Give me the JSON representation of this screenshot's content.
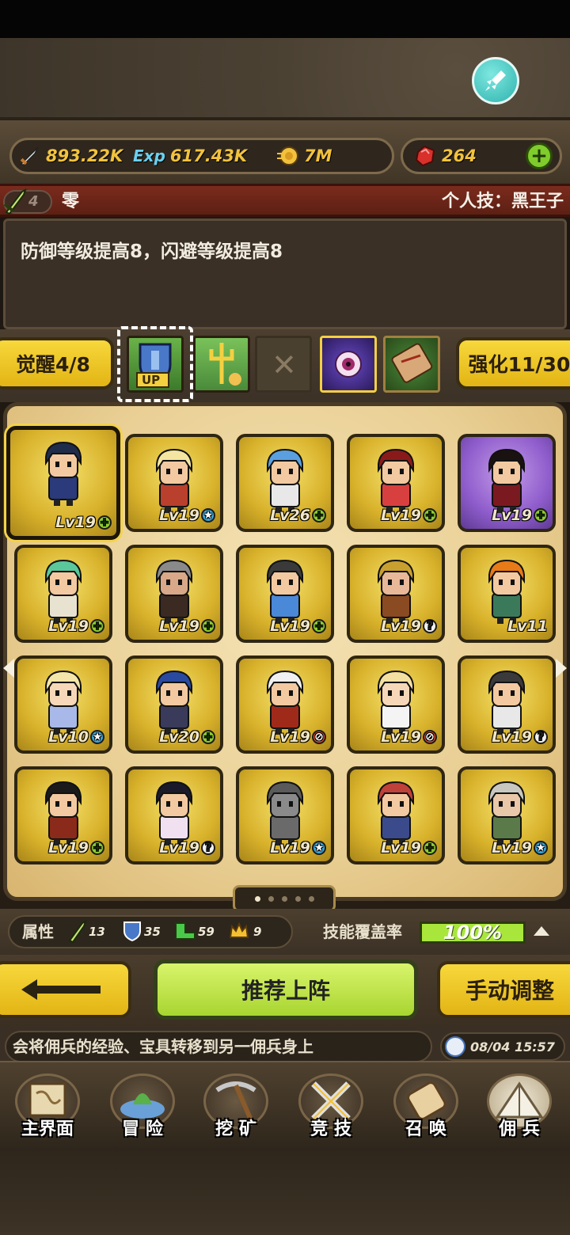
{
  "resources": {
    "attack": "893.22K",
    "exp_label": "Exp",
    "exp": "617.43K",
    "gold": "7M",
    "gems": "264"
  },
  "hero": {
    "name_rank": "4",
    "name": "零",
    "personal_skill": "个人技：黑王子",
    "description": "防御等级提高8，闪避等级提高8"
  },
  "tabs": {
    "awaken": "觉醒4/8",
    "enhance": "强化11/30",
    "up_label": "UP",
    "x_mark": "✕"
  },
  "cards": [
    {
      "level": "Lv19",
      "badge": "+",
      "badge_type": "green",
      "skin": "#f2c9a0",
      "hair": "#1f2c4a",
      "body": "#2b3a7a",
      "style": "selected"
    },
    {
      "level": "Lv19",
      "badge": "★",
      "badge_type": "blue",
      "skin": "#f2c9a0",
      "hair": "#f4e6a0",
      "body": "#b8402c"
    },
    {
      "level": "Lv26",
      "badge": "+",
      "badge_type": "green",
      "skin": "#f2c9a0",
      "hair": "#5aa0e0",
      "body": "#e8e8e8"
    },
    {
      "level": "Lv19",
      "badge": "+",
      "badge_type": "green",
      "skin": "#f2c9a0",
      "hair": "#8a1a1a",
      "body": "#d84040"
    },
    {
      "level": "Lv19",
      "badge": "+",
      "badge_type": "green",
      "skin": "#f2c9a0",
      "hair": "#1a1210",
      "body": "#7a1a20",
      "style": "purple"
    },
    {
      "level": "Lv19",
      "badge": "+",
      "badge_type": "green",
      "skin": "#f2c9a0",
      "hair": "#5ac89a",
      "body": "#e8e2d0"
    },
    {
      "level": "Lv19",
      "badge": "+",
      "badge_type": "green",
      "skin": "#d8a888",
      "hair": "#8a8a8a",
      "body": "#3a2a22"
    },
    {
      "level": "Lv19",
      "badge": "+",
      "badge_type": "green",
      "skin": "#f2c9a0",
      "hair": "#3a3a3a",
      "body": "#4a88d8"
    },
    {
      "level": "Lv19",
      "badge": "?",
      "badge_type": "q",
      "skin": "#e8b898",
      "hair": "#c8a030",
      "body": "#8a4a22"
    },
    {
      "level": "Lv11",
      "badge": "",
      "badge_type": "none",
      "skin": "#f2c9a0",
      "hair": "#e87a18",
      "body": "#3a7a5a"
    },
    {
      "level": "Lv10",
      "badge": "★",
      "badge_type": "blue",
      "skin": "#f6d8b8",
      "hair": "#f4e6a8",
      "body": "#a8b8e8"
    },
    {
      "level": "Lv20",
      "badge": "+",
      "badge_type": "green",
      "skin": "#f2c9a0",
      "hair": "#2a4aa0",
      "body": "#3a3a5a"
    },
    {
      "level": "Lv19",
      "badge": "⊘",
      "badge_type": "red",
      "skin": "#f2c9a0",
      "hair": "#f0f0f0",
      "body": "#a02a1a"
    },
    {
      "level": "Lv19",
      "badge": "⊘",
      "badge_type": "red",
      "skin": "#f6d8b8",
      "hair": "#f4e0a0",
      "body": "#f4f4f4"
    },
    {
      "level": "Lv19",
      "badge": "?",
      "badge_type": "q",
      "skin": "#f2c9a0",
      "hair": "#3a3a3a",
      "body": "#e8e8e8"
    },
    {
      "level": "Lv19",
      "badge": "+",
      "badge_type": "green",
      "skin": "#f2c9a0",
      "hair": "#1a1a1a",
      "body": "#8a2a1a"
    },
    {
      "level": "Lv19",
      "badge": "?",
      "badge_type": "q",
      "skin": "#f2c9a0",
      "hair": "#1a1a2a",
      "body": "#f0e0f0"
    },
    {
      "level": "Lv19",
      "badge": "★",
      "badge_type": "blue",
      "skin": "#8a8a8a",
      "hair": "#5a5a5a",
      "body": "#6a6a6a"
    },
    {
      "level": "Lv19",
      "badge": "+",
      "badge_type": "green",
      "skin": "#f2c9a0",
      "hair": "#c0403a",
      "body": "#3a4a8a"
    },
    {
      "level": "Lv19",
      "badge": "★",
      "badge_type": "blue",
      "skin": "#e8c8a8",
      "hair": "#c8c8c0",
      "body": "#5a7a4a"
    }
  ],
  "attributes": {
    "label": "属性",
    "sword": "13",
    "shield": "35",
    "boot": "59",
    "crown": "9",
    "coverage_label": "技能覆盖率",
    "coverage": "100%"
  },
  "actions": {
    "recommend": "推荐上阵",
    "manual": "手动调整"
  },
  "info": {
    "message": "会将佣兵的经验、宝具转移到另一佣兵身上",
    "time": "08/04 15:57"
  },
  "nav": [
    {
      "label": "主界面"
    },
    {
      "label": "冒 险"
    },
    {
      "label": "挖 矿"
    },
    {
      "label": "竞 技"
    },
    {
      "label": "召 唤"
    },
    {
      "label": "佣 兵"
    }
  ],
  "colors": {
    "gold_text": "#f2c23d",
    "panel": "#e9cf94",
    "green_button": "#a8d531",
    "yellow_button": "#e3b415"
  }
}
